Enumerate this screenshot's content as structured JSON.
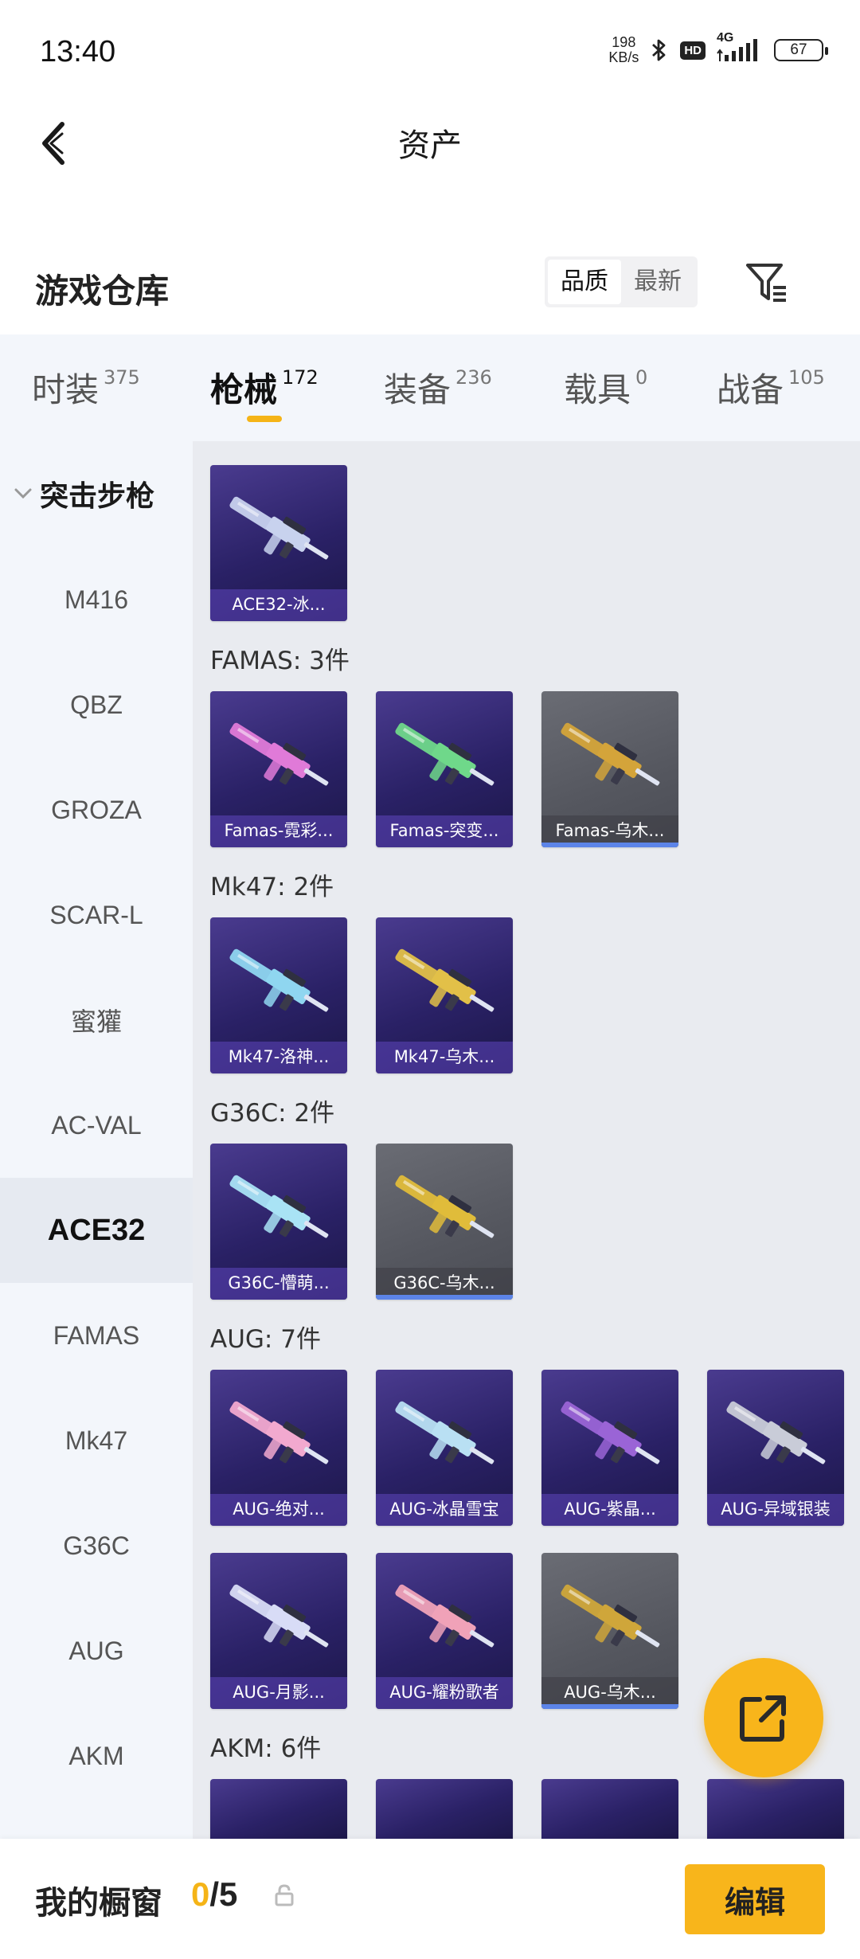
{
  "status_bar": {
    "time": "13:40",
    "net_speed_value": "198",
    "net_speed_unit": "KB/s",
    "hd_label": "HD",
    "network_label": "4G",
    "battery": "67"
  },
  "header": {
    "title": "资产"
  },
  "section": {
    "title": "游戏仓库",
    "sort_options": [
      "品质",
      "最新"
    ]
  },
  "tabs": [
    {
      "label": "时装",
      "count": "375"
    },
    {
      "label": "枪械",
      "count": "172"
    },
    {
      "label": "装备",
      "count": "236"
    },
    {
      "label": "载具",
      "count": "0"
    },
    {
      "label": "战备",
      "count": "105"
    }
  ],
  "sidebar": {
    "group": "突击步枪",
    "items": [
      "M416",
      "QBZ",
      "GROZA",
      "SCAR-L",
      "蜜獾",
      "AC-VAL",
      "ACE32",
      "FAMAS",
      "Mk47",
      "G36C",
      "AUG",
      "AKM"
    ]
  },
  "content": {
    "first_row": [
      {
        "name": "ACE32-冰...",
        "color": "#c8d2ee",
        "rarity": "purple"
      }
    ],
    "groups": [
      {
        "label": "FAMAS: 3件",
        "items": [
          {
            "name": "Famas-霓彩...",
            "color": "#e07ad8",
            "rarity": "purple"
          },
          {
            "name": "Famas-突变...",
            "color": "#6fd88a",
            "rarity": "purple"
          },
          {
            "name": "Famas-乌木...",
            "color": "#d4a43a",
            "rarity": "grey"
          }
        ]
      },
      {
        "label": "Mk47: 2件",
        "items": [
          {
            "name": "Mk47-洛神...",
            "color": "#8fd6f0",
            "rarity": "purple"
          },
          {
            "name": "Mk47-乌木...",
            "color": "#e2c048",
            "rarity": "purple"
          }
        ]
      },
      {
        "label": "G36C: 2件",
        "items": [
          {
            "name": "G36C-懵萌...",
            "color": "#a9e3f5",
            "rarity": "purple"
          },
          {
            "name": "G36C-乌木...",
            "color": "#e0bc3a",
            "rarity": "grey"
          }
        ]
      },
      {
        "label": "AUG: 7件",
        "items": [
          {
            "name": "AUG-绝对...",
            "color": "#f2a9cf",
            "rarity": "purple"
          },
          {
            "name": "AUG-冰晶雪宝",
            "color": "#b9e0f3",
            "rarity": "purple"
          },
          {
            "name": "AUG-紫晶...",
            "color": "#9a64d6",
            "rarity": "purple"
          },
          {
            "name": "AUG-异域银装",
            "color": "#c9ccd8",
            "rarity": "purple"
          },
          {
            "name": "AUG-月影...",
            "color": "#d8dcf6",
            "rarity": "purple"
          },
          {
            "name": "AUG-耀粉歌者",
            "color": "#f0a2b8",
            "rarity": "purple"
          },
          {
            "name": "AUG-乌木...",
            "color": "#cfa63a",
            "rarity": "grey"
          }
        ]
      },
      {
        "label": "AKM: 6件",
        "items": []
      }
    ]
  },
  "bottom_bar": {
    "label": "我的橱窗",
    "current": "0",
    "separator": "/",
    "max": "5",
    "edit_label": "编辑"
  },
  "colors": {
    "accent": "#f8b51b",
    "card_purple": "#2a2166",
    "card_grey": "#55575f",
    "panel_bg": "#e9ebf0",
    "sidebar_bg": "#f3f6fb"
  }
}
